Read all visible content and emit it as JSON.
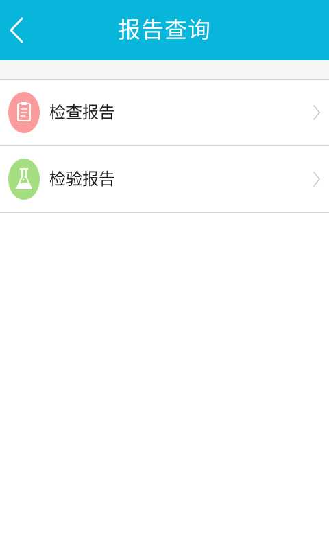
{
  "header": {
    "title": "报告查询",
    "back_icon": "chevron-left-icon",
    "background": "#08b6dc"
  },
  "items": [
    {
      "label": "检查报告",
      "icon": "clipboard-icon",
      "icon_color": "#fa9c9c",
      "trailing_icon": "chevron-right-icon"
    },
    {
      "label": "检验报告",
      "icon": "flask-icon",
      "icon_color": "#a4de80",
      "trailing_icon": "chevron-right-icon"
    }
  ]
}
